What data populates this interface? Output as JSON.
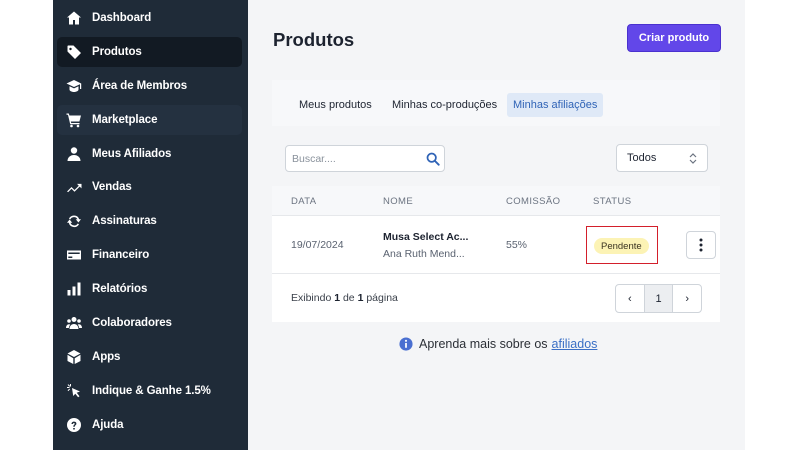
{
  "sidebar": {
    "items": [
      {
        "label": "Dashboard",
        "icon": "home-icon"
      },
      {
        "label": "Produtos",
        "icon": "tag-icon"
      },
      {
        "label": "Área de Membros",
        "icon": "graduation-cap-icon"
      },
      {
        "label": "Marketplace",
        "icon": "cart-icon"
      },
      {
        "label": "Meus Afiliados",
        "icon": "user-icon"
      },
      {
        "label": "Vendas",
        "icon": "trend-up-icon"
      },
      {
        "label": "Assinaturas",
        "icon": "refresh-icon"
      },
      {
        "label": "Financeiro",
        "icon": "credit-card-icon"
      },
      {
        "label": "Relatórios",
        "icon": "bar-chart-icon"
      },
      {
        "label": "Colaboradores",
        "icon": "users-icon"
      },
      {
        "label": "Apps",
        "icon": "cube-icon"
      },
      {
        "label": "Indique & Ganhe 1.5%",
        "icon": "pointer-click-icon"
      },
      {
        "label": "Ajuda",
        "icon": "help-circle-icon"
      }
    ],
    "active_index": 1
  },
  "header": {
    "title": "Produtos",
    "create_label": "Criar produto"
  },
  "tabs": [
    {
      "label": "Meus produtos"
    },
    {
      "label": "Minhas co-produções"
    },
    {
      "label": "Minhas afiliações"
    }
  ],
  "filters": {
    "search_placeholder": "Buscar....",
    "select_value": "Todos"
  },
  "table": {
    "headers": [
      "DATA",
      "NOME",
      "COMISSÃO",
      "STATUS"
    ],
    "rows": [
      {
        "date": "19/07/2024",
        "name": "Musa Select Ac...",
        "owner": "Ana Ruth Mend...",
        "commission": "55%",
        "status": "Pendente"
      }
    ]
  },
  "pagination": {
    "prefix": "Exibindo",
    "current": "1",
    "middle": "de",
    "total": "1",
    "suffix": "página",
    "prev_label": "‹",
    "page_label": "1",
    "next_label": "›"
  },
  "learn": {
    "text": "Aprenda mais sobre os",
    "link": "afiliados"
  },
  "colors": {
    "sidebar_bg": "#1f2b38",
    "accent": "#6247e9",
    "badge_bg": "#fcf3b5",
    "link": "#3a6fc5"
  }
}
